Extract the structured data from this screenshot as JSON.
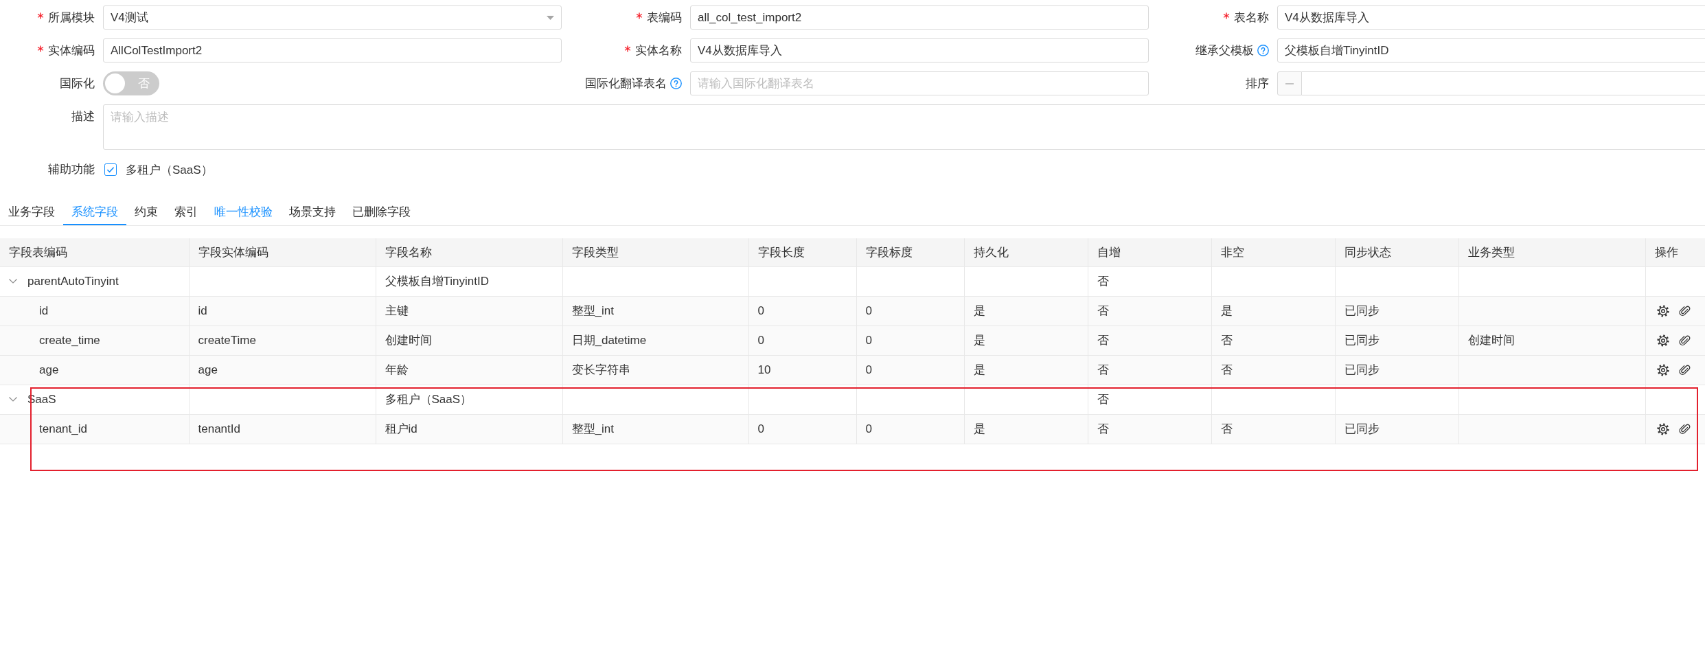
{
  "form": {
    "fields": [
      {
        "kind": "select",
        "label": "所属模块",
        "required": true,
        "help": false,
        "value": "V4测试"
      },
      {
        "kind": "text",
        "label": "表编码",
        "required": true,
        "help": false,
        "value": "all_col_test_import2"
      },
      {
        "kind": "text",
        "label": "表名称",
        "required": true,
        "help": false,
        "value": "V4从数据库导入"
      },
      {
        "kind": "text",
        "label": "实体编码",
        "required": true,
        "help": false,
        "value": "AllColTestImport2"
      },
      {
        "kind": "text",
        "label": "实体名称",
        "required": true,
        "help": false,
        "value": "V4从数据库导入"
      },
      {
        "kind": "text",
        "label": "继承父模板",
        "required": false,
        "help": true,
        "value": "父模板自增TinyintID"
      },
      {
        "kind": "switch",
        "label": "国际化",
        "required": false,
        "help": false,
        "on": false,
        "text": "否"
      },
      {
        "kind": "text",
        "label": "国际化翻译表名",
        "required": false,
        "help": true,
        "placeholder": "请输入国际化翻译表名"
      },
      {
        "kind": "number",
        "label": "排序",
        "required": false,
        "help": false
      },
      {
        "kind": "textarea",
        "label": "描述",
        "required": false,
        "help": false,
        "placeholder": "请输入描述"
      },
      {
        "kind": "checkboxes",
        "label": "辅助功能",
        "required": false,
        "help": false,
        "options": [
          {
            "label": "多租户（SaaS）",
            "checked": true
          }
        ]
      }
    ]
  },
  "tabs": [
    {
      "label": "业务字段",
      "selected": false,
      "hovered": false
    },
    {
      "label": "系统字段",
      "selected": true,
      "hovered": false
    },
    {
      "label": "约束",
      "selected": false,
      "hovered": false
    },
    {
      "label": "索引",
      "selected": false,
      "hovered": false
    },
    {
      "label": "唯一性校验",
      "selected": false,
      "hovered": true
    },
    {
      "label": "场景支持",
      "selected": false,
      "hovered": false
    },
    {
      "label": "已删除字段",
      "selected": false,
      "hovered": false
    }
  ],
  "table": {
    "columns": [
      "字段表编码",
      "字段实体编码",
      "字段名称",
      "字段类型",
      "字段长度",
      "字段标度",
      "持久化",
      "自增",
      "非空",
      "同步状态",
      "业务类型",
      "操作"
    ],
    "rows": [
      {
        "cells": [
          "parentAutoTinyint",
          null,
          "父模板自增TinyintID",
          null,
          null,
          null,
          null,
          "否",
          null,
          null,
          null
        ],
        "expanded": true,
        "highlighted": false,
        "children": [
          {
            "cells": [
              "id",
              "id",
              "主键",
              "整型_int",
              "0",
              "0",
              "是",
              "否",
              "是",
              "已同步",
              null
            ]
          },
          {
            "cells": [
              "create_time",
              "createTime",
              "创建时间",
              "日期_datetime",
              "0",
              "0",
              "是",
              "否",
              "否",
              "已同步",
              "创建时间"
            ]
          },
          {
            "cells": [
              "age",
              "age",
              "年龄",
              "变长字符串",
              "10",
              "0",
              "是",
              "否",
              "否",
              "已同步",
              null
            ]
          }
        ]
      },
      {
        "cells": [
          "SaaS",
          null,
          "多租户（SaaS）",
          null,
          null,
          null,
          null,
          "否",
          null,
          null,
          null
        ],
        "expanded": true,
        "highlighted": true,
        "children": [
          {
            "cells": [
              "tenant_id",
              "tenantId",
              "租户id",
              "整型_int",
              "0",
              "0",
              "是",
              "否",
              "否",
              "已同步",
              null
            ]
          }
        ]
      }
    ]
  }
}
